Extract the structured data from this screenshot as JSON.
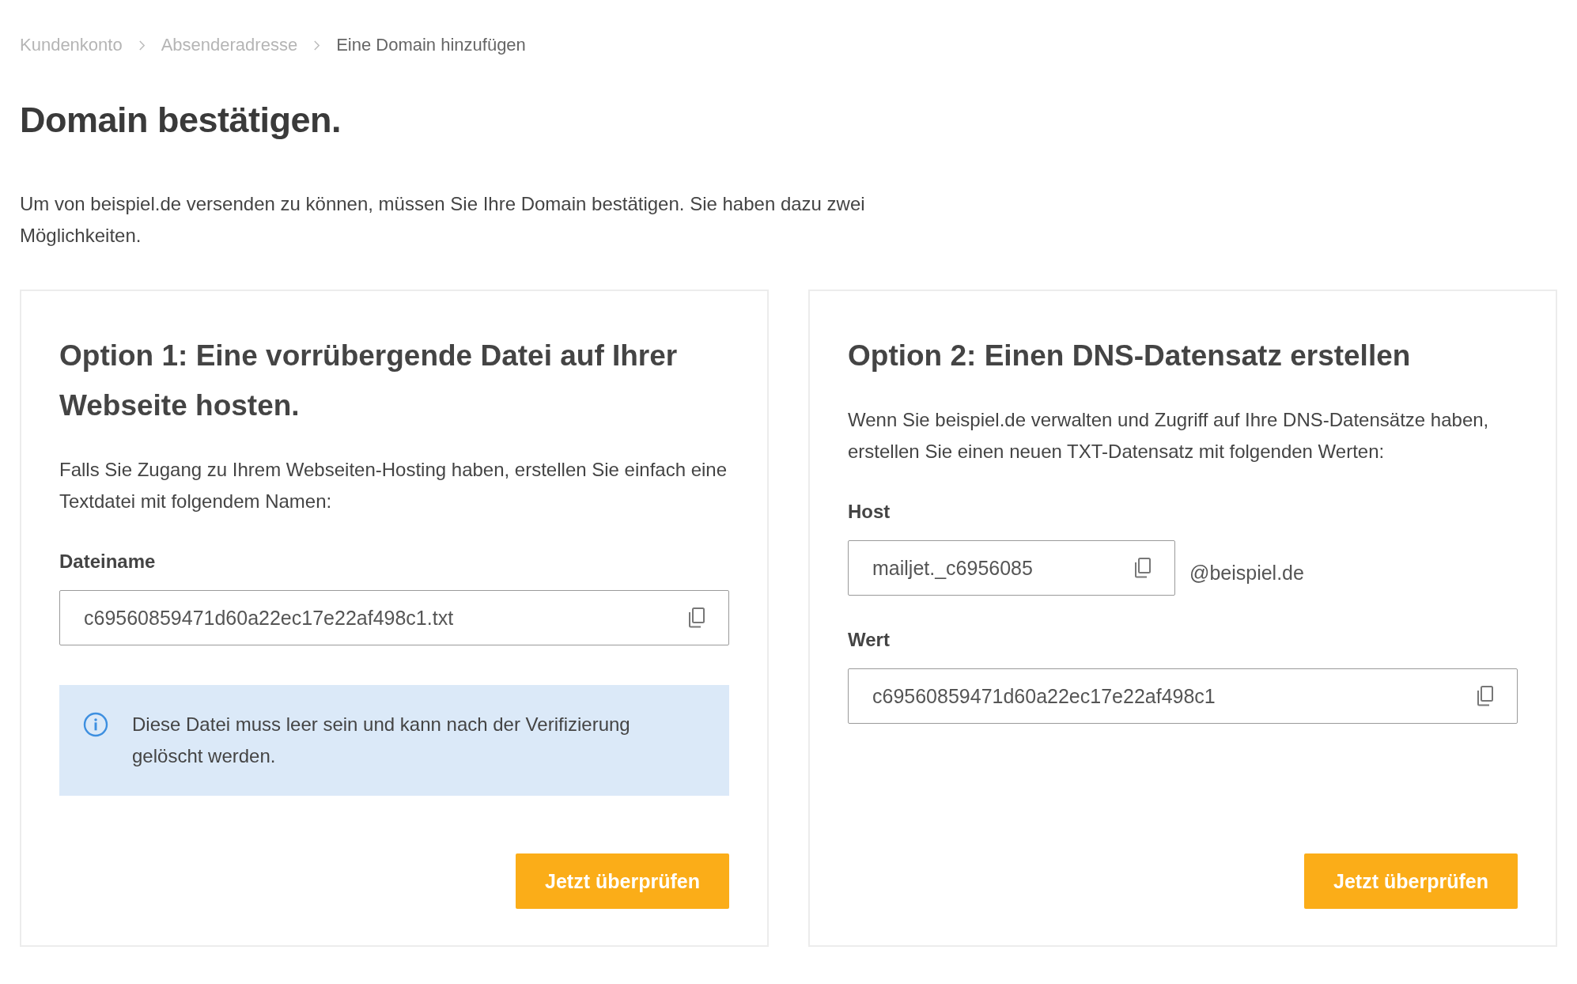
{
  "breadcrumb": [
    {
      "label": "Kundenkonto",
      "selected": false
    },
    {
      "label": "Absenderadresse",
      "selected": false
    },
    {
      "label": "Eine Domain hinzufügen",
      "selected": true
    }
  ],
  "title": "Domain bestätigen.",
  "intro": "Um von beispiel.de versenden zu können, müssen Sie Ihre Domain bestätigen. Sie haben dazu zwei Möglichkeiten.",
  "options": [
    {
      "title": "Option 1: Eine vorrübergende Datei auf Ihrer Webseite hosten.",
      "text": "Falls Sie Zugang zu Ihrem Webseiten-Hosting haben, erstellen Sie einfach eine Textdatei mit folgendem Namen:",
      "fields": [
        {
          "kind": "wide",
          "label": "Dateiname",
          "value": "c69560859471d60a22ec17e22af498c1.txt"
        }
      ],
      "info": "Diese Datei muss leer sein und kann nach der Verifizierung gelöscht werden.",
      "button": "Jetzt überprüfen"
    },
    {
      "title": "Option 2: Einen DNS-Datensatz erstellen",
      "text": "Wenn Sie beispiel.de verwalten und Zugriff auf Ihre DNS-Datensätze haben, erstellen Sie einen neuen TXT-Datensatz mit folgenden Werten:",
      "fields": [
        {
          "kind": "short",
          "label": "Host",
          "value": "mailjet._c6956085",
          "suffix": "@beispiel.de"
        },
        {
          "kind": "wide",
          "label": "Wert",
          "value": "c69560859471d60a22ec17e22af498c1"
        }
      ],
      "button": "Jetzt überprüfen"
    }
  ]
}
